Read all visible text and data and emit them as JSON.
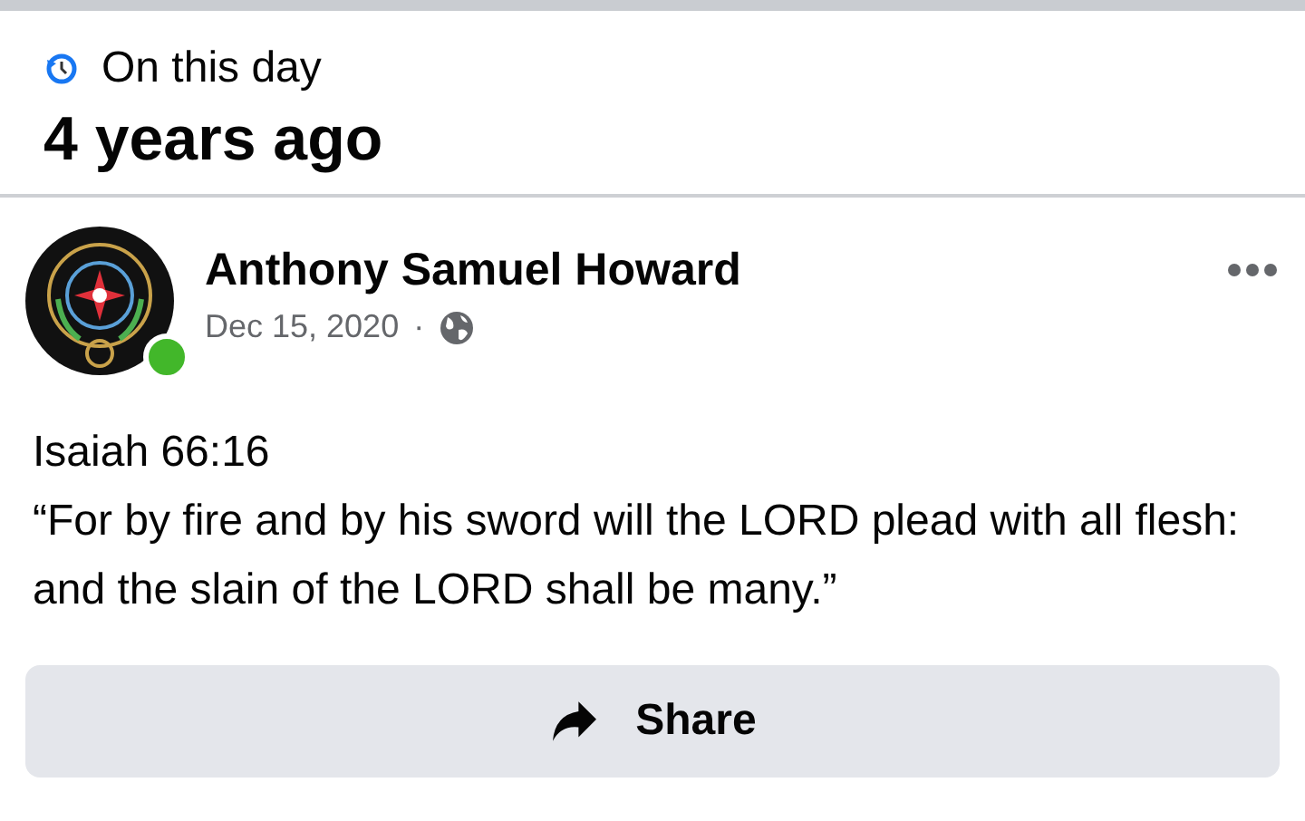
{
  "memory": {
    "label": "On this day",
    "title": "4 years ago"
  },
  "post": {
    "author": "Anthony Samuel Howard",
    "online": true,
    "date": "Dec 15, 2020",
    "separator": "·",
    "text": [
      "Isaiah 66:16",
      "“For by fire and by his sword will the LORD plead with all flesh: and the slain of the LORD shall be many.”"
    ]
  },
  "share_button": {
    "label": "Share"
  }
}
